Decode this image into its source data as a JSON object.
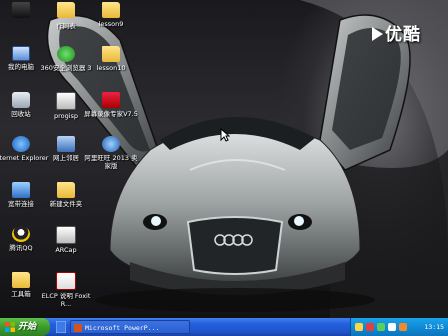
{
  "desktop": {
    "icons": [
      {
        "label": "",
        "kind": "dark"
      },
      {
        "label": "",
        "kind": "folder"
      },
      {
        "label": "作同表",
        "kind": "folder"
      },
      {
        "label": "lesson9",
        "kind": "folder"
      },
      {
        "label": "我的电脑",
        "kind": "computer"
      },
      {
        "label": "360安全浏览器 3",
        "kind": "shield"
      },
      {
        "label": "lesson10",
        "kind": "folder"
      },
      {
        "label": "回收站",
        "kind": "recycle"
      },
      {
        "label": "progisp",
        "kind": "app2"
      },
      {
        "label": "屏幕录像专家V7.5",
        "kind": "app"
      },
      {
        "label": "Internet Explorer",
        "kind": "ie"
      },
      {
        "label": "网上邻居",
        "kind": "network"
      },
      {
        "label": "阿里旺旺 2013 卖家版",
        "kind": "blue"
      },
      {
        "label": "宽带连接",
        "kind": "broadband"
      },
      {
        "label": "新建文件夹",
        "kind": "folder"
      },
      {
        "label": "腾讯QQ",
        "kind": "qq"
      },
      {
        "label": "ARCap",
        "kind": "app2"
      },
      {
        "label": "工具箱",
        "kind": "folder"
      },
      {
        "label": "ELCP 说明 Foxit R...",
        "kind": "pdf"
      }
    ]
  },
  "watermark": {
    "text": "优酷"
  },
  "taskbar": {
    "start_label": "开始",
    "active_window": "Microsoft PowerP...",
    "clock": "13:15",
    "colors": {
      "start": "#3c9b2d",
      "bar": "#245edb",
      "tray": "#0f86d2"
    }
  }
}
